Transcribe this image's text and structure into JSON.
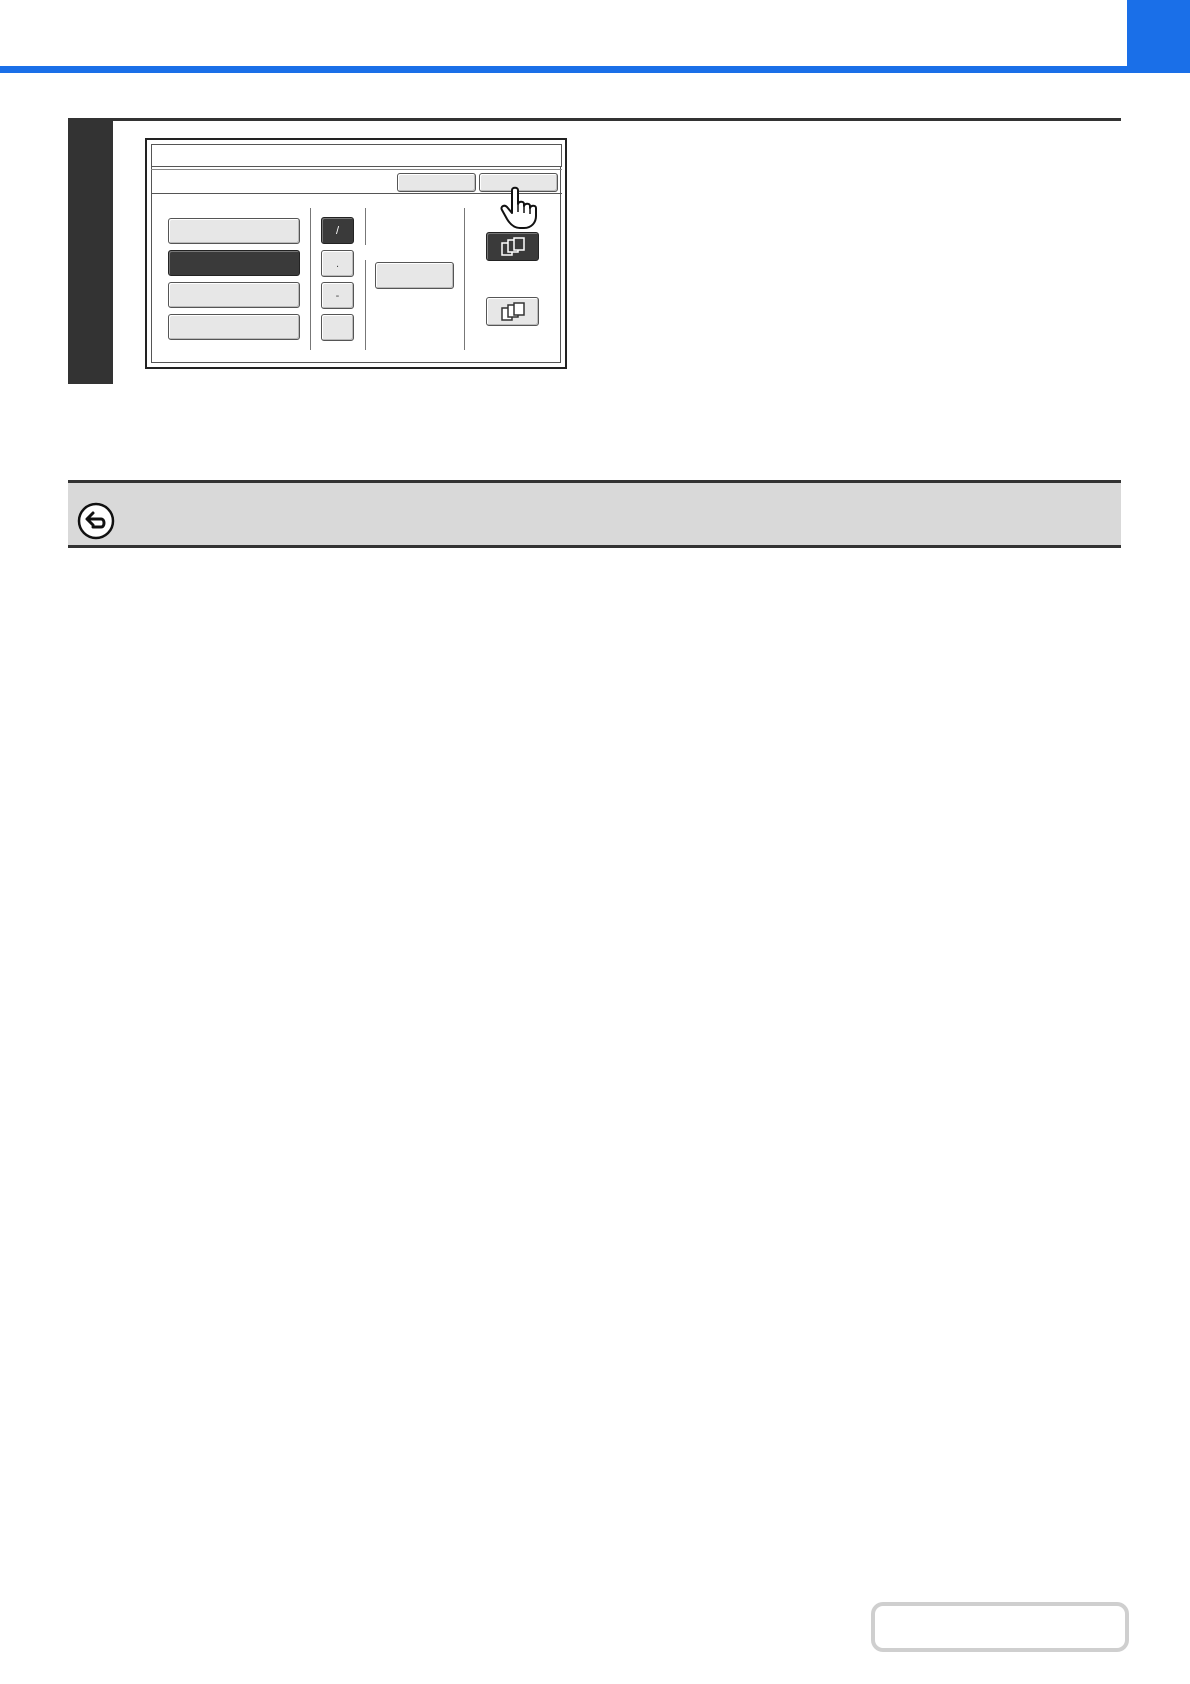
{
  "header": {
    "accent_color": "#1a6fe8"
  },
  "step": {
    "number": "",
    "panel": {
      "title": "",
      "toolbar": {
        "left_button_label": "",
        "right_button_label": ""
      },
      "left_options": [
        {
          "label": "",
          "selected": false
        },
        {
          "label": "",
          "selected": true
        },
        {
          "label": "",
          "selected": false
        },
        {
          "label": "",
          "selected": false
        }
      ],
      "symbol_keys": [
        {
          "label": "/",
          "selected": true
        },
        {
          "label": ".",
          "selected": false
        },
        {
          "label": "-",
          "selected": false
        },
        {
          "label": "",
          "selected": false
        }
      ],
      "middle_button_label": "",
      "right_icons": [
        {
          "icon": "copy-pages-icon",
          "selected": true
        },
        {
          "icon": "copy-pages-icon",
          "selected": false
        }
      ],
      "pointer_icon": "pointing-hand-icon"
    }
  },
  "note": {
    "icon": "back-arrow-icon",
    "text": ""
  },
  "footer": {
    "page_indicator": ""
  }
}
